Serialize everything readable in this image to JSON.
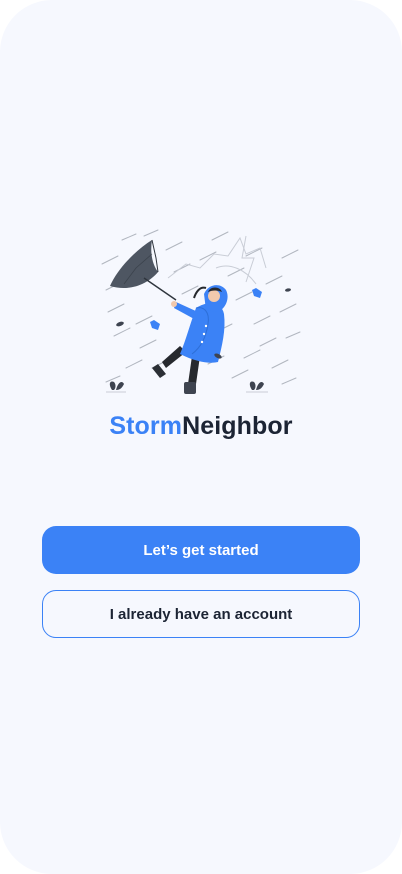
{
  "app": {
    "brand_part1": "Storm",
    "brand_part2": "Neighbor"
  },
  "actions": {
    "primary_label": "Let’s get started",
    "secondary_label": "I already have an account"
  },
  "colors": {
    "accent": "#3b82f6",
    "text_dark": "#1c2434",
    "background": "#f6f8fe"
  },
  "illustration": {
    "icon": "woman-with-umbrella-in-storm-illustration"
  }
}
